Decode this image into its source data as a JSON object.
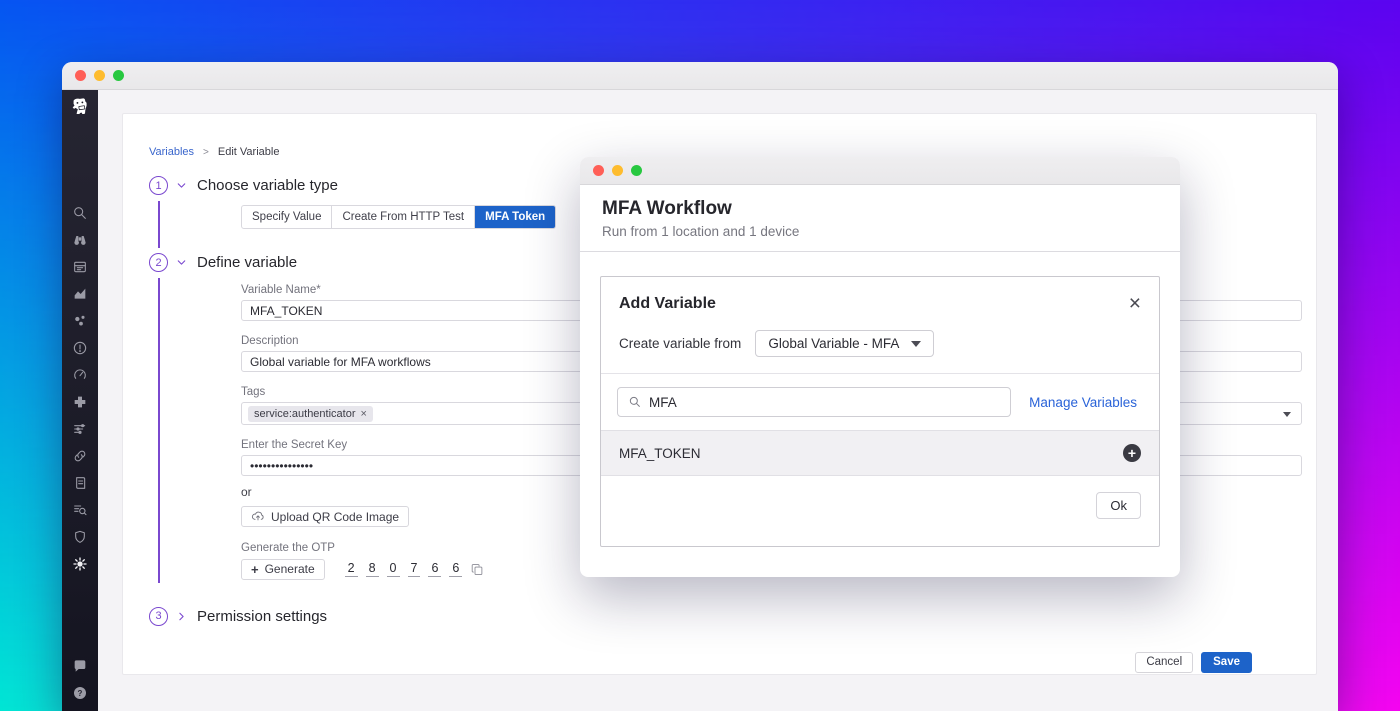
{
  "colors": {
    "accent_blue": "#1d63c9",
    "link_blue": "#2a63d8",
    "step_purple": "#7a48cf",
    "gradient_corners": [
      "#0655f2",
      "#5b04f0",
      "#00e6d4",
      "#f503f0"
    ]
  },
  "sidebar": {
    "items": [
      "datadog-logo",
      "search",
      "watchdog",
      "events",
      "metrics",
      "infrastructure",
      "monitors",
      "apm",
      "integrations",
      "traces",
      "service-map",
      "logs",
      "log-explorer",
      "security",
      "synthetics"
    ],
    "active_item": "synthetics",
    "bottom_items": [
      "support-chat",
      "help"
    ]
  },
  "breadcrumb": {
    "link": "Variables",
    "sep": ">",
    "current": "Edit Variable"
  },
  "steps": {
    "one": {
      "number": "1",
      "title": "Choose variable type",
      "tabs": [
        {
          "label": "Specify Value",
          "selected": false
        },
        {
          "label": "Create From HTTP Test",
          "selected": false
        },
        {
          "label": "MFA Token",
          "selected": true
        }
      ]
    },
    "two": {
      "number": "2",
      "title": "Define variable",
      "fields": {
        "variable_name": {
          "label": "Variable Name*",
          "value": "MFA_TOKEN"
        },
        "description": {
          "label": "Description",
          "value": "Global variable for MFA workflows"
        },
        "tags": {
          "label": "Tags",
          "tag": "service:authenticator",
          "remove_glyph": "×"
        },
        "secret": {
          "label": "Enter the Secret Key",
          "value": "•••••••••••••••"
        },
        "or_text": "or",
        "upload_label": "Upload QR Code Image",
        "otp": {
          "label": "Generate the OTP",
          "plus_glyph": "+",
          "generate_label": "Generate",
          "digits": [
            "2",
            "8",
            "0",
            "7",
            "6",
            "6"
          ]
        }
      }
    },
    "three": {
      "number": "3",
      "title": "Permission settings"
    }
  },
  "footer": {
    "cancel": "Cancel",
    "save": "Save"
  },
  "modal": {
    "title": "MFA Workflow",
    "subtitle": "Run from 1 location and 1 device",
    "card": {
      "title": "Add Variable",
      "close_glyph": "×",
      "create_from_label": "Create variable from",
      "dropdown_value": "Global Variable - MFA",
      "search_value": "MFA",
      "manage_label": "Manage Variables",
      "result_name": "MFA_TOKEN",
      "ok_label": "Ok"
    }
  }
}
